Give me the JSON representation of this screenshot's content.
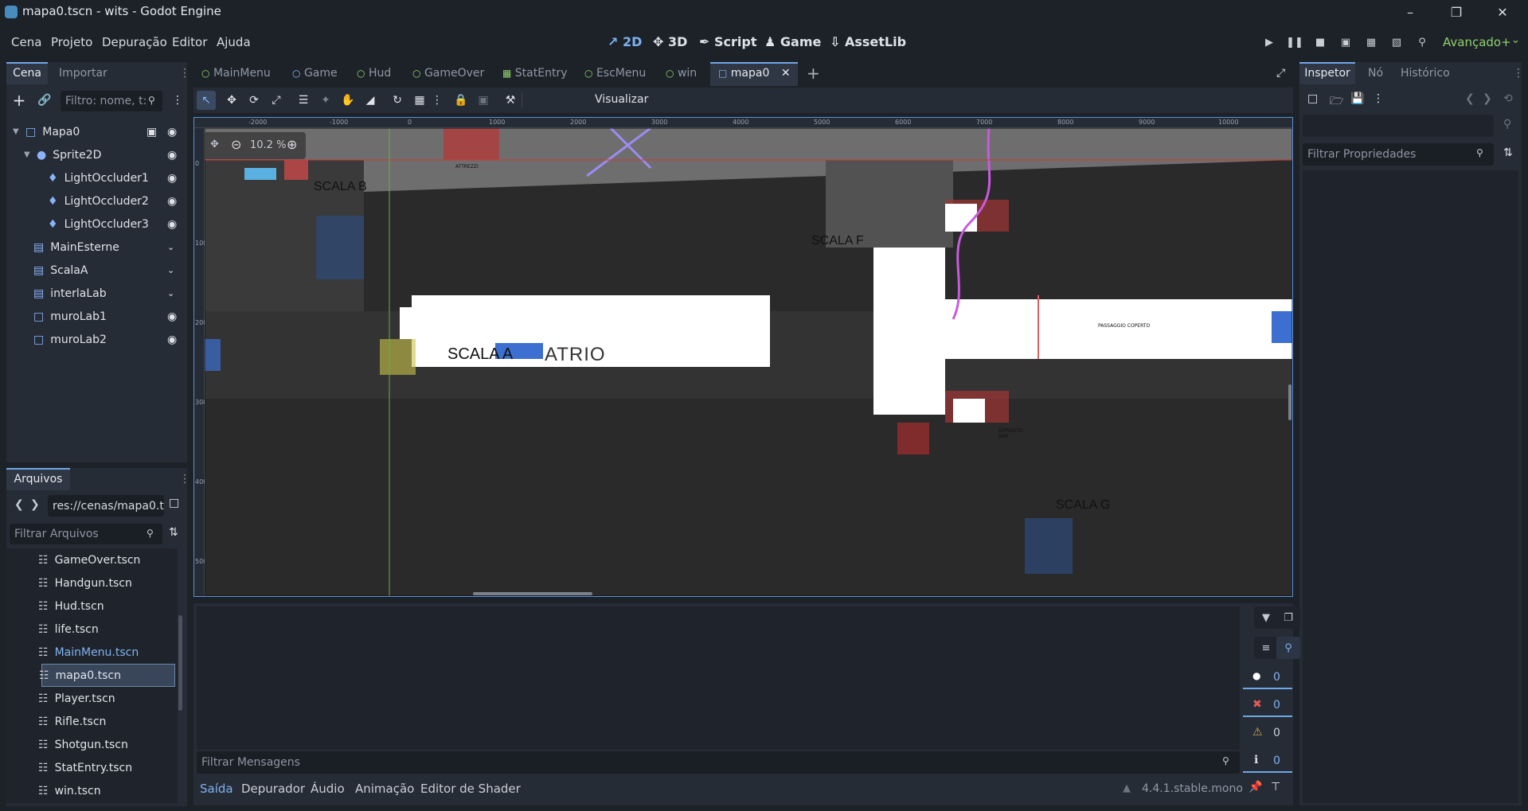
{
  "window": {
    "title": "mapa0.tscn - wits - Godot Engine"
  },
  "menu": [
    "Cena",
    "Projeto",
    "Depuração",
    "Editor",
    "Ajuda"
  ],
  "modes": {
    "2d": "2D",
    "3d": "3D",
    "script": "Script",
    "game": "Game",
    "assetlib": "AssetLib"
  },
  "renderer": "Avançado+",
  "scene_dock": {
    "tab_scene": "Cena",
    "tab_import": "Importar",
    "filter_placeholder": "Filtro: nome, t:",
    "nodes": [
      {
        "label": "Mapa0",
        "icon": "node2d-icon"
      },
      {
        "label": "Sprite2D",
        "icon": "sprite2d-icon"
      },
      {
        "label": "LightOccluder1",
        "icon": "light-occluder-icon"
      },
      {
        "label": "LightOccluder2",
        "icon": "light-occluder-icon"
      },
      {
        "label": "LightOccluder3",
        "icon": "light-occluder-icon"
      },
      {
        "label": "MainEsterne",
        "icon": "tilemap-icon"
      },
      {
        "label": "ScalaA",
        "icon": "tilemap-icon"
      },
      {
        "label": "interlaLab",
        "icon": "tilemap-icon"
      },
      {
        "label": "muroLab1",
        "icon": "staticbody-icon"
      },
      {
        "label": "muroLab2",
        "icon": "staticbody-icon"
      }
    ]
  },
  "filesystem": {
    "tab": "Arquivos",
    "path": "res://cenas/mapa0.t",
    "filter_placeholder": "Filtrar Arquivos",
    "files": [
      "GameOver.tscn",
      "Handgun.tscn",
      "Hud.tscn",
      "life.tscn",
      "MainMenu.tscn",
      "mapa0.tscn",
      "Player.tscn",
      "Rifle.tscn",
      "Shotgun.tscn",
      "StatEntry.tscn",
      "win.tscn"
    ],
    "selected": "mapa0.tscn",
    "highlighted": "MainMenu.tscn"
  },
  "editor_tabs": [
    "MainMenu",
    "Game",
    "Hud",
    "GameOver",
    "StatEntry",
    "EscMenu",
    "win",
    "mapa0"
  ],
  "active_editor_tab": "mapa0",
  "toolbar": {
    "view_label": "Visualizar"
  },
  "viewport": {
    "zoom": "10.2 %",
    "ruler_labels": [
      "-2000",
      "-1000",
      "0",
      "1000",
      "2000",
      "3000",
      "4000",
      "5000",
      "6000",
      "7000",
      "8000",
      "9000",
      "10000"
    ],
    "vruler_labels": [
      "0",
      "1000",
      "2000",
      "3000",
      "4000",
      "5000"
    ],
    "map_labels": {
      "scala_b": "SCALA B",
      "scala_a": "SCALA A",
      "atrio": "ATRIO",
      "scala_f": "SCALA F",
      "scala_g": "SCALA G",
      "passaggio": "PASSAGGIO COPERTO",
      "deposito": "DEPOSITO BAR",
      "attrezzi": "ATTREZZI"
    }
  },
  "inspector": {
    "tab_inspector": "Inspetor",
    "tab_node": "Nó",
    "tab_history": "Histórico",
    "filter_placeholder": "Filtrar Propriedades"
  },
  "output": {
    "filter_placeholder": "Filtrar Mensagens",
    "counts": {
      "errors": "0",
      "errors2": "0",
      "warnings": "0",
      "info": "0",
      "messages": "0"
    },
    "tabs": [
      "Saída",
      "Depurador",
      "Áudio",
      "Animação",
      "Editor de Shader"
    ],
    "version": "4.4.1.stable.mono"
  },
  "colors": {
    "accent": "#6fa6e8",
    "background": "#1d2229",
    "panel": "#262c36"
  }
}
